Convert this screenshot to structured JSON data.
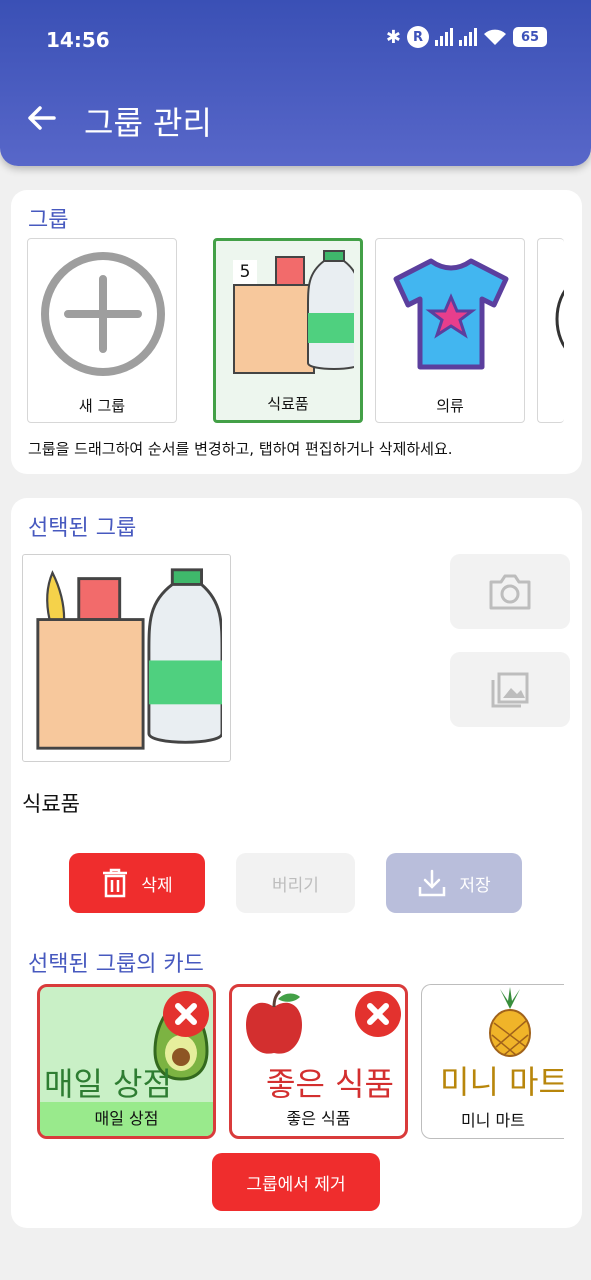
{
  "status": {
    "time": "14:56",
    "battery": "65",
    "roaming": "R"
  },
  "header": {
    "title": "그룹 관리"
  },
  "groups": {
    "section_title": "그룹",
    "items": [
      {
        "label": "새 그룹"
      },
      {
        "label": "식료품",
        "badge": "5",
        "selected": true
      },
      {
        "label": "의류"
      }
    ],
    "hint": "그룹을 드래그하여 순서를 변경하고, 탭하여 편집하거나 삭제하세요."
  },
  "selected": {
    "section_title": "선택된 그룹",
    "name": "식료품",
    "buttons": {
      "delete": "삭제",
      "discard": "버리기",
      "save": "저장"
    }
  },
  "cards": {
    "section_title": "선택된 그룹의 카드",
    "items": [
      {
        "big_text": "매일 상점",
        "label": "매일 상점",
        "color": "#2e7d32"
      },
      {
        "big_text": "좋은 식품",
        "label": "좋은 식품",
        "color": "#d32f2f"
      },
      {
        "big_text": "미니 마트",
        "label": "미니 마트",
        "color": "#b8860b"
      }
    ],
    "remove_button": "그룹에서 제거"
  },
  "colors": {
    "primary": "#4759bf",
    "danger": "#ef2d2d",
    "selected_border": "#43a047"
  }
}
